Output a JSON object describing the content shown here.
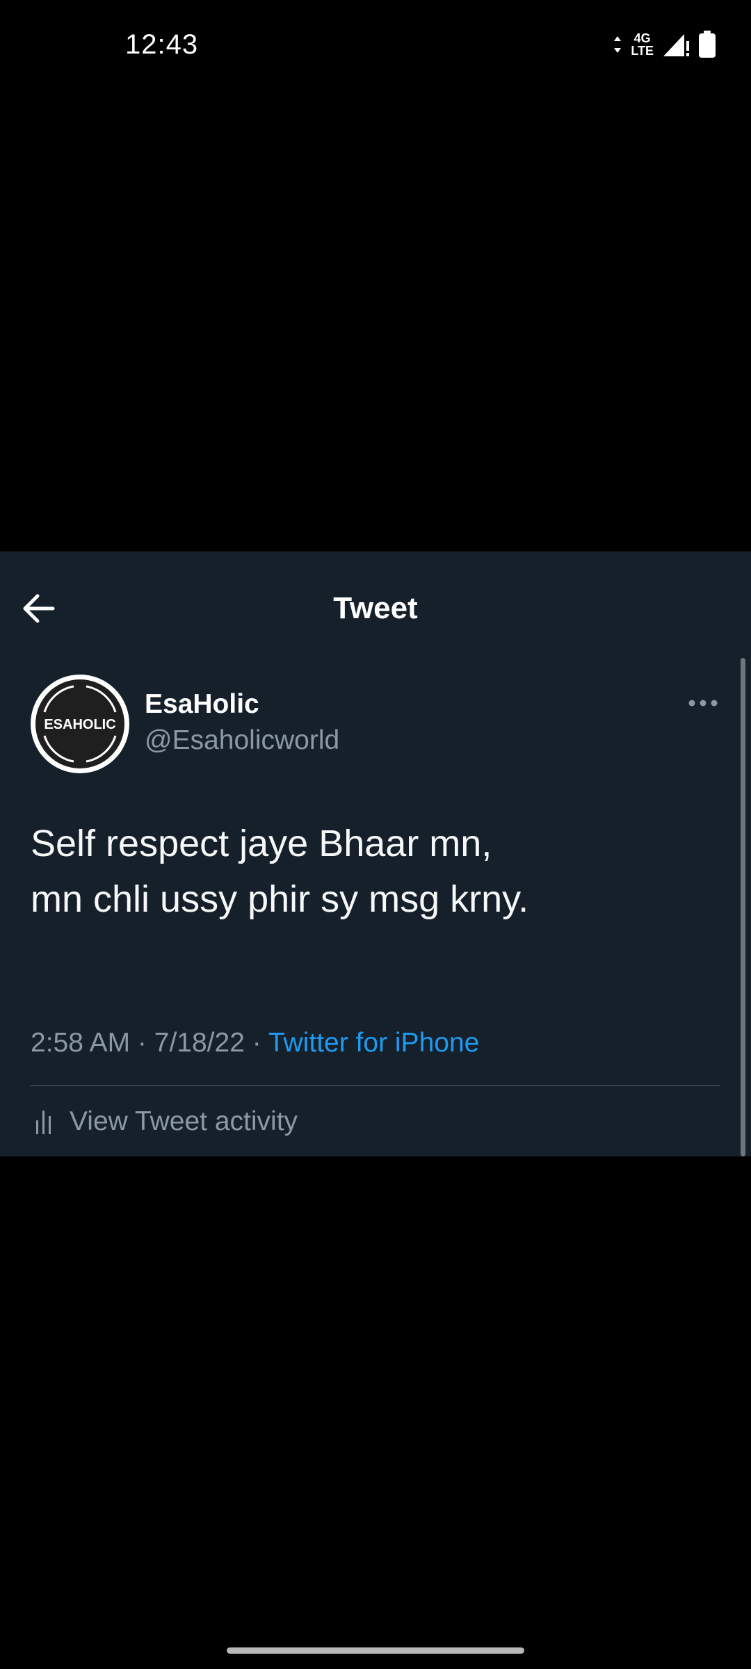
{
  "status_bar": {
    "time": "12:43",
    "network_top": "4G",
    "network_bottom": "LTE",
    "icons": [
      "data-arrows-icon",
      "signal-icon",
      "battery-icon"
    ]
  },
  "header": {
    "title": "Tweet",
    "back_icon": "arrow-left-icon"
  },
  "tweet": {
    "avatar_text": "ESAHOLIC",
    "display_name": "EsaHolic",
    "handle": "@Esaholicworld",
    "text_lines": [
      "Self respect jaye Bhaar mn,",
      "mn chli ussy phir sy msg krny."
    ],
    "time": "2:58 AM",
    "separator": " · ",
    "date": "7/18/22",
    "source": "Twitter for iPhone",
    "activity_label": "View Tweet activity"
  },
  "colors": {
    "background": "#000000",
    "card": "#15202b",
    "secondary_text": "#8b98a5",
    "link": "#1d9bf0",
    "divider": "#38444d"
  }
}
